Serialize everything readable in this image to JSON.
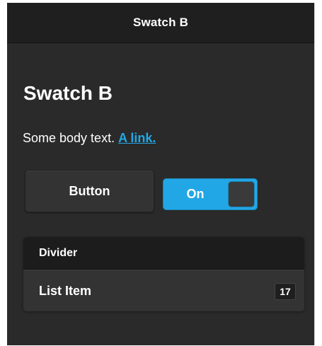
{
  "header": {
    "title": "Swatch B"
  },
  "content": {
    "title": "Swatch B",
    "body_text": "Some body text.",
    "link_text": "A link."
  },
  "controls": {
    "button_label": "Button",
    "flip_label": "On",
    "flip_state": "on"
  },
  "list": {
    "divider": "Divider",
    "items": [
      {
        "label": "List Item",
        "count": "17"
      }
    ]
  },
  "colors": {
    "accent": "#22a7e6",
    "background": "#2a2a2a",
    "header_bg": "#1f1f1f"
  }
}
